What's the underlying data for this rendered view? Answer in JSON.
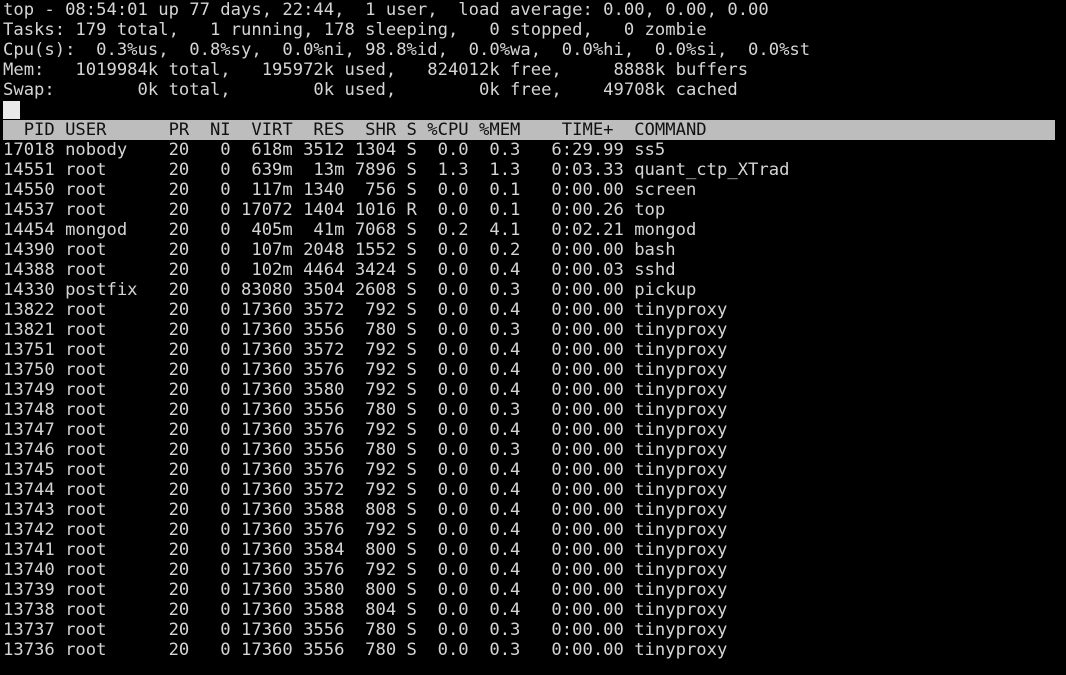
{
  "terminal": {
    "program": "top",
    "background_color": "#000000",
    "foreground_color": "#d4d4d4",
    "header_bar_color": "#bdbdbd",
    "header_bar_text_color": "#111111"
  },
  "summary": {
    "uptime_line": "top - 08:54:01 up 77 days, 22:44,  1 user,  load average: 0.00, 0.00, 0.00",
    "tasks_line": "Tasks: 179 total,   1 running, 178 sleeping,   0 stopped,   0 zombie",
    "cpu_line": "Cpu(s):  0.3%us,  0.8%sy,  0.0%ni, 98.8%id,  0.0%wa,  0.0%hi,  0.0%si,  0.0%st",
    "mem_line": "Mem:   1019984k total,   195972k used,   824012k free,     8888k buffers",
    "swap_line": "Swap:        0k total,        0k used,        0k free,    49708k cached",
    "fields": {
      "time": "08:54:01",
      "uptime": "77 days, 22:44",
      "users": "1 user",
      "load_avg_1": "0.00",
      "load_avg_5": "0.00",
      "load_avg_15": "0.00",
      "tasks_total": "179",
      "tasks_running": "1",
      "tasks_sleeping": "178",
      "tasks_stopped": "0",
      "tasks_zombie": "0",
      "cpu_us": "0.3",
      "cpu_sy": "0.8",
      "cpu_ni": "0.0",
      "cpu_id": "98.8",
      "cpu_wa": "0.0",
      "cpu_hi": "0.0",
      "cpu_si": "0.0",
      "cpu_st": "0.0",
      "mem_total": "1019984k",
      "mem_used": "195972k",
      "mem_free": "824012k",
      "mem_buffers": "8888k",
      "swap_total": "0k",
      "swap_used": "0k",
      "swap_free": "0k",
      "swap_cached": "49708k"
    }
  },
  "process_table": {
    "header_line": "  PID USER      PR  NI  VIRT  RES  SHR S %CPU %MEM    TIME+  COMMAND                    ",
    "columns": [
      "PID",
      "USER",
      "PR",
      "NI",
      "VIRT",
      "RES",
      "SHR",
      "S",
      "%CPU",
      "%MEM",
      "TIME+",
      "COMMAND"
    ],
    "rows": [
      {
        "line": "17018 nobody    20   0  618m 3512 1304 S  0.0  0.3   6:29.99 ss5",
        "pid": "17018",
        "user": "nobody",
        "pr": "20",
        "ni": "0",
        "virt": "618m",
        "res": "3512",
        "shr": "1304",
        "s": "S",
        "cpu": "0.0",
        "mem": "0.3",
        "time": "6:29.99",
        "command": "ss5"
      },
      {
        "line": "14551 root      20   0  639m  13m 7896 S  1.3  1.3   0:03.33 quant_ctp_XTrad",
        "pid": "14551",
        "user": "root",
        "pr": "20",
        "ni": "0",
        "virt": "639m",
        "res": "13m",
        "shr": "7896",
        "s": "S",
        "cpu": "1.3",
        "mem": "1.3",
        "time": "0:03.33",
        "command": "quant_ctp_XTrad"
      },
      {
        "line": "14550 root      20   0  117m 1340  756 S  0.0  0.1   0:00.00 screen",
        "pid": "14550",
        "user": "root",
        "pr": "20",
        "ni": "0",
        "virt": "117m",
        "res": "1340",
        "shr": "756",
        "s": "S",
        "cpu": "0.0",
        "mem": "0.1",
        "time": "0:00.00",
        "command": "screen"
      },
      {
        "line": "14537 root      20   0 17072 1404 1016 R  0.0  0.1   0:00.26 top",
        "pid": "14537",
        "user": "root",
        "pr": "20",
        "ni": "0",
        "virt": "17072",
        "res": "1404",
        "shr": "1016",
        "s": "R",
        "cpu": "0.0",
        "mem": "0.1",
        "time": "0:00.26",
        "command": "top"
      },
      {
        "line": "14454 mongod    20   0  405m  41m 7068 S  0.2  4.1   0:02.21 mongod",
        "pid": "14454",
        "user": "mongod",
        "pr": "20",
        "ni": "0",
        "virt": "405m",
        "res": "41m",
        "shr": "7068",
        "s": "S",
        "cpu": "0.2",
        "mem": "4.1",
        "time": "0:02.21",
        "command": "mongod"
      },
      {
        "line": "14390 root      20   0  107m 2048 1552 S  0.0  0.2   0:00.00 bash",
        "pid": "14390",
        "user": "root",
        "pr": "20",
        "ni": "0",
        "virt": "107m",
        "res": "2048",
        "shr": "1552",
        "s": "S",
        "cpu": "0.0",
        "mem": "0.2",
        "time": "0:00.00",
        "command": "bash"
      },
      {
        "line": "14388 root      20   0  102m 4464 3424 S  0.0  0.4   0:00.03 sshd",
        "pid": "14388",
        "user": "root",
        "pr": "20",
        "ni": "0",
        "virt": "102m",
        "res": "4464",
        "shr": "3424",
        "s": "S",
        "cpu": "0.0",
        "mem": "0.4",
        "time": "0:00.03",
        "command": "sshd"
      },
      {
        "line": "14330 postfix   20   0 83080 3504 2608 S  0.0  0.3   0:00.00 pickup",
        "pid": "14330",
        "user": "postfix",
        "pr": "20",
        "ni": "0",
        "virt": "83080",
        "res": "3504",
        "shr": "2608",
        "s": "S",
        "cpu": "0.0",
        "mem": "0.3",
        "time": "0:00.00",
        "command": "pickup"
      },
      {
        "line": "13822 root      20   0 17360 3572  792 S  0.0  0.4   0:00.00 tinyproxy",
        "pid": "13822",
        "user": "root",
        "pr": "20",
        "ni": "0",
        "virt": "17360",
        "res": "3572",
        "shr": "792",
        "s": "S",
        "cpu": "0.0",
        "mem": "0.4",
        "time": "0:00.00",
        "command": "tinyproxy"
      },
      {
        "line": "13821 root      20   0 17360 3556  780 S  0.0  0.3   0:00.00 tinyproxy",
        "pid": "13821",
        "user": "root",
        "pr": "20",
        "ni": "0",
        "virt": "17360",
        "res": "3556",
        "shr": "780",
        "s": "S",
        "cpu": "0.0",
        "mem": "0.3",
        "time": "0:00.00",
        "command": "tinyproxy"
      },
      {
        "line": "13751 root      20   0 17360 3572  792 S  0.0  0.4   0:00.00 tinyproxy",
        "pid": "13751",
        "user": "root",
        "pr": "20",
        "ni": "0",
        "virt": "17360",
        "res": "3572",
        "shr": "792",
        "s": "S",
        "cpu": "0.0",
        "mem": "0.4",
        "time": "0:00.00",
        "command": "tinyproxy"
      },
      {
        "line": "13750 root      20   0 17360 3576  792 S  0.0  0.4   0:00.00 tinyproxy",
        "pid": "13750",
        "user": "root",
        "pr": "20",
        "ni": "0",
        "virt": "17360",
        "res": "3576",
        "shr": "792",
        "s": "S",
        "cpu": "0.0",
        "mem": "0.4",
        "time": "0:00.00",
        "command": "tinyproxy"
      },
      {
        "line": "13749 root      20   0 17360 3580  792 S  0.0  0.4   0:00.00 tinyproxy",
        "pid": "13749",
        "user": "root",
        "pr": "20",
        "ni": "0",
        "virt": "17360",
        "res": "3580",
        "shr": "792",
        "s": "S",
        "cpu": "0.0",
        "mem": "0.4",
        "time": "0:00.00",
        "command": "tinyproxy"
      },
      {
        "line": "13748 root      20   0 17360 3556  780 S  0.0  0.3   0:00.00 tinyproxy",
        "pid": "13748",
        "user": "root",
        "pr": "20",
        "ni": "0",
        "virt": "17360",
        "res": "3556",
        "shr": "780",
        "s": "S",
        "cpu": "0.0",
        "mem": "0.3",
        "time": "0:00.00",
        "command": "tinyproxy"
      },
      {
        "line": "13747 root      20   0 17360 3576  792 S  0.0  0.4   0:00.00 tinyproxy",
        "pid": "13747",
        "user": "root",
        "pr": "20",
        "ni": "0",
        "virt": "17360",
        "res": "3576",
        "shr": "792",
        "s": "S",
        "cpu": "0.0",
        "mem": "0.4",
        "time": "0:00.00",
        "command": "tinyproxy"
      },
      {
        "line": "13746 root      20   0 17360 3556  780 S  0.0  0.3   0:00.00 tinyproxy",
        "pid": "13746",
        "user": "root",
        "pr": "20",
        "ni": "0",
        "virt": "17360",
        "res": "3556",
        "shr": "780",
        "s": "S",
        "cpu": "0.0",
        "mem": "0.3",
        "time": "0:00.00",
        "command": "tinyproxy"
      },
      {
        "line": "13745 root      20   0 17360 3576  792 S  0.0  0.4   0:00.00 tinyproxy",
        "pid": "13745",
        "user": "root",
        "pr": "20",
        "ni": "0",
        "virt": "17360",
        "res": "3576",
        "shr": "792",
        "s": "S",
        "cpu": "0.0",
        "mem": "0.4",
        "time": "0:00.00",
        "command": "tinyproxy"
      },
      {
        "line": "13744 root      20   0 17360 3572  792 S  0.0  0.4   0:00.00 tinyproxy",
        "pid": "13744",
        "user": "root",
        "pr": "20",
        "ni": "0",
        "virt": "17360",
        "res": "3572",
        "shr": "792",
        "s": "S",
        "cpu": "0.0",
        "mem": "0.4",
        "time": "0:00.00",
        "command": "tinyproxy"
      },
      {
        "line": "13743 root      20   0 17360 3588  808 S  0.0  0.4   0:00.00 tinyproxy",
        "pid": "13743",
        "user": "root",
        "pr": "20",
        "ni": "0",
        "virt": "17360",
        "res": "3588",
        "shr": "808",
        "s": "S",
        "cpu": "0.0",
        "mem": "0.4",
        "time": "0:00.00",
        "command": "tinyproxy"
      },
      {
        "line": "13742 root      20   0 17360 3576  792 S  0.0  0.4   0:00.00 tinyproxy",
        "pid": "13742",
        "user": "root",
        "pr": "20",
        "ni": "0",
        "virt": "17360",
        "res": "3576",
        "shr": "792",
        "s": "S",
        "cpu": "0.0",
        "mem": "0.4",
        "time": "0:00.00",
        "command": "tinyproxy"
      },
      {
        "line": "13741 root      20   0 17360 3584  800 S  0.0  0.4   0:00.00 tinyproxy",
        "pid": "13741",
        "user": "root",
        "pr": "20",
        "ni": "0",
        "virt": "17360",
        "res": "3584",
        "shr": "800",
        "s": "S",
        "cpu": "0.0",
        "mem": "0.4",
        "time": "0:00.00",
        "command": "tinyproxy"
      },
      {
        "line": "13740 root      20   0 17360 3576  792 S  0.0  0.4   0:00.00 tinyproxy",
        "pid": "13740",
        "user": "root",
        "pr": "20",
        "ni": "0",
        "virt": "17360",
        "res": "3576",
        "shr": "792",
        "s": "S",
        "cpu": "0.0",
        "mem": "0.4",
        "time": "0:00.00",
        "command": "tinyproxy"
      },
      {
        "line": "13739 root      20   0 17360 3580  800 S  0.0  0.4   0:00.00 tinyproxy",
        "pid": "13739",
        "user": "root",
        "pr": "20",
        "ni": "0",
        "virt": "17360",
        "res": "3580",
        "shr": "800",
        "s": "S",
        "cpu": "0.0",
        "mem": "0.4",
        "time": "0:00.00",
        "command": "tinyproxy"
      },
      {
        "line": "13738 root      20   0 17360 3588  804 S  0.0  0.4   0:00.00 tinyproxy",
        "pid": "13738",
        "user": "root",
        "pr": "20",
        "ni": "0",
        "virt": "17360",
        "res": "3588",
        "shr": "804",
        "s": "S",
        "cpu": "0.0",
        "mem": "0.4",
        "time": "0:00.00",
        "command": "tinyproxy"
      },
      {
        "line": "13737 root      20   0 17360 3556  780 S  0.0  0.3   0:00.00 tinyproxy",
        "pid": "13737",
        "user": "root",
        "pr": "20",
        "ni": "0",
        "virt": "17360",
        "res": "3556",
        "shr": "780",
        "s": "S",
        "cpu": "0.0",
        "mem": "0.3",
        "time": "0:00.00",
        "command": "tinyproxy"
      },
      {
        "line": "13736 root      20   0 17360 3556  780 S  0.0  0.3   0:00.00 tinyproxy",
        "pid": "13736",
        "user": "root",
        "pr": "20",
        "ni": "0",
        "virt": "17360",
        "res": "3556",
        "shr": "780",
        "s": "S",
        "cpu": "0.0",
        "mem": "0.3",
        "time": "0:00.00",
        "command": "tinyproxy"
      }
    ]
  }
}
